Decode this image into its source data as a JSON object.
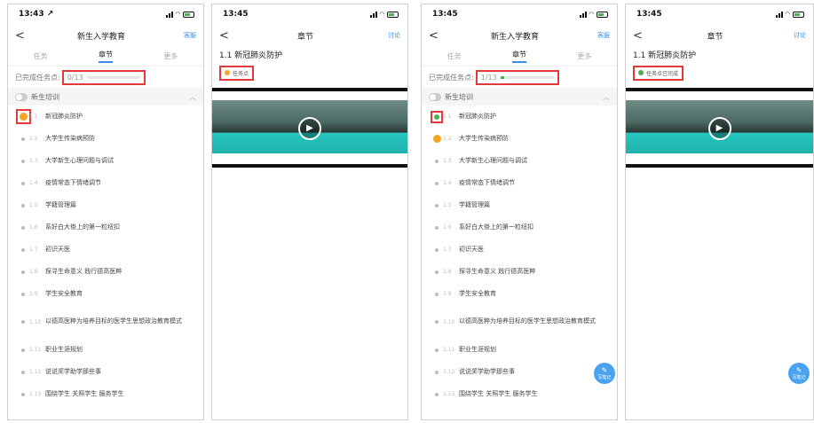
{
  "colors": {
    "accent": "#3a8ee6",
    "highlight": "#e23a3a",
    "done": "#4caf50",
    "current": "#f5a623"
  },
  "icons": {
    "back": "chevron-left-icon",
    "toggle": "toggle-icon",
    "collapse": "chevron-up-icon",
    "play": "play-icon",
    "note": "note-edit-icon"
  },
  "panel1": {
    "time": "13:43 ↗",
    "nav": {
      "back": "<",
      "title": "新生入学教育",
      "action": "客服"
    },
    "tabs": [
      "任务",
      "章节",
      "更多"
    ],
    "progress": {
      "label": "已完成任务点:",
      "count": "0/13",
      "fraction": 0
    },
    "section": "新生培训",
    "items": [
      {
        "num": "1.1",
        "text": "新冠肺炎防护",
        "state": "current"
      },
      {
        "num": "1.2",
        "text": "大学生传染病预防",
        "state": "none"
      },
      {
        "num": "1.3",
        "text": "大学新生心理问题与调试",
        "state": "none"
      },
      {
        "num": "1.4",
        "text": "疫情常态下情绪调节",
        "state": "none"
      },
      {
        "num": "1.5",
        "text": "学籍管理篇",
        "state": "none"
      },
      {
        "num": "1.6",
        "text": "系好白大褂上的第一粒纽扣",
        "state": "none"
      },
      {
        "num": "1.7",
        "text": "初识天医",
        "state": "none"
      },
      {
        "num": "1.8",
        "text": "探寻生命意义 践行德高医粹",
        "state": "none"
      },
      {
        "num": "1.9",
        "text": "学生安全教育",
        "state": "none"
      },
      {
        "num": "1.10",
        "text": "以德高医粹为培养目标的医学生思想政治教育模式",
        "state": "none"
      },
      {
        "num": "1.11",
        "text": "职业生涯规划",
        "state": "none"
      },
      {
        "num": "1.12",
        "text": "说说奖学助学那些事",
        "state": "none"
      },
      {
        "num": "1.13",
        "text": "围绕学生 关照学生 服务学生",
        "state": "none"
      }
    ]
  },
  "panel2": {
    "time": "13:45",
    "nav": {
      "back": "<",
      "title": "章节",
      "action": "讨论"
    },
    "chapter": "1.1 新冠肺炎防护",
    "badge": "任务点"
  },
  "panel3": {
    "time": "13:45",
    "nav": {
      "back": "<",
      "title": "新生入学教育",
      "action": "客服"
    },
    "tabs": [
      "任务",
      "章节",
      "更多"
    ],
    "progress": {
      "label": "已完成任务点:",
      "count": "1/13",
      "fraction": 0.077
    },
    "section": "新生培训",
    "items": [
      {
        "num": "1.1",
        "text": "新冠肺炎防护",
        "state": "done"
      },
      {
        "num": "1.2",
        "text": "大学生传染病预防",
        "state": "current"
      },
      {
        "num": "1.3",
        "text": "大学新生心理问题与调试",
        "state": "none"
      },
      {
        "num": "1.4",
        "text": "疫情常态下情绪调节",
        "state": "none"
      },
      {
        "num": "1.5",
        "text": "学籍管理篇",
        "state": "none"
      },
      {
        "num": "1.6",
        "text": "系好白大褂上的第一粒纽扣",
        "state": "none"
      },
      {
        "num": "1.7",
        "text": "初识天医",
        "state": "none"
      },
      {
        "num": "1.8",
        "text": "探寻生命意义 践行德高医粹",
        "state": "none"
      },
      {
        "num": "1.9",
        "text": "学生安全教育",
        "state": "none"
      },
      {
        "num": "1.10",
        "text": "以德高医粹为培养目标的医学生思想政治教育模式",
        "state": "none"
      },
      {
        "num": "1.11",
        "text": "职业生涯规划",
        "state": "none"
      },
      {
        "num": "1.12",
        "text": "说说奖学助学那些事",
        "state": "none"
      },
      {
        "num": "1.13",
        "text": "围绕学生 关照学生 服务学生",
        "state": "none"
      }
    ],
    "fab": "写笔记"
  },
  "panel4": {
    "time": "13:45",
    "nav": {
      "back": "<",
      "title": "章节",
      "action": "讨论"
    },
    "chapter": "1.1 新冠肺炎防护",
    "badge": "任务点已完成",
    "fab": "写笔记"
  }
}
